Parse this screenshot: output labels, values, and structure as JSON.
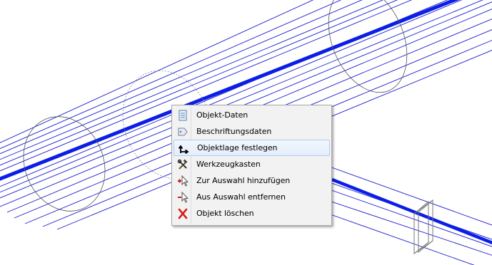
{
  "context_menu": {
    "items": [
      {
        "label": "Objekt-Daten",
        "icon": "document-icon"
      },
      {
        "label": "Beschriftungsdaten",
        "icon": "label-tag-icon"
      },
      {
        "label": "Objektlage festlegen",
        "icon": "arrow-up-right-icon",
        "highlighted": true
      },
      {
        "label": "Werkzeugkasten",
        "icon": "tools-icon"
      },
      {
        "label": "Zur Auswahl hinzufügen",
        "icon": "cursor-add-icon"
      },
      {
        "label": "Aus Auswahl entfernen",
        "icon": "cursor-remove-icon"
      },
      {
        "label": "Objekt löschen",
        "icon": "delete-x-icon"
      }
    ]
  },
  "colors": {
    "pipe_line": "#1a1ad0",
    "pipe_axis": "#0a1ee6",
    "ellipse": "#555555",
    "menu_bg": "#f2f2f2",
    "highlight_border": "#aeccf1"
  }
}
